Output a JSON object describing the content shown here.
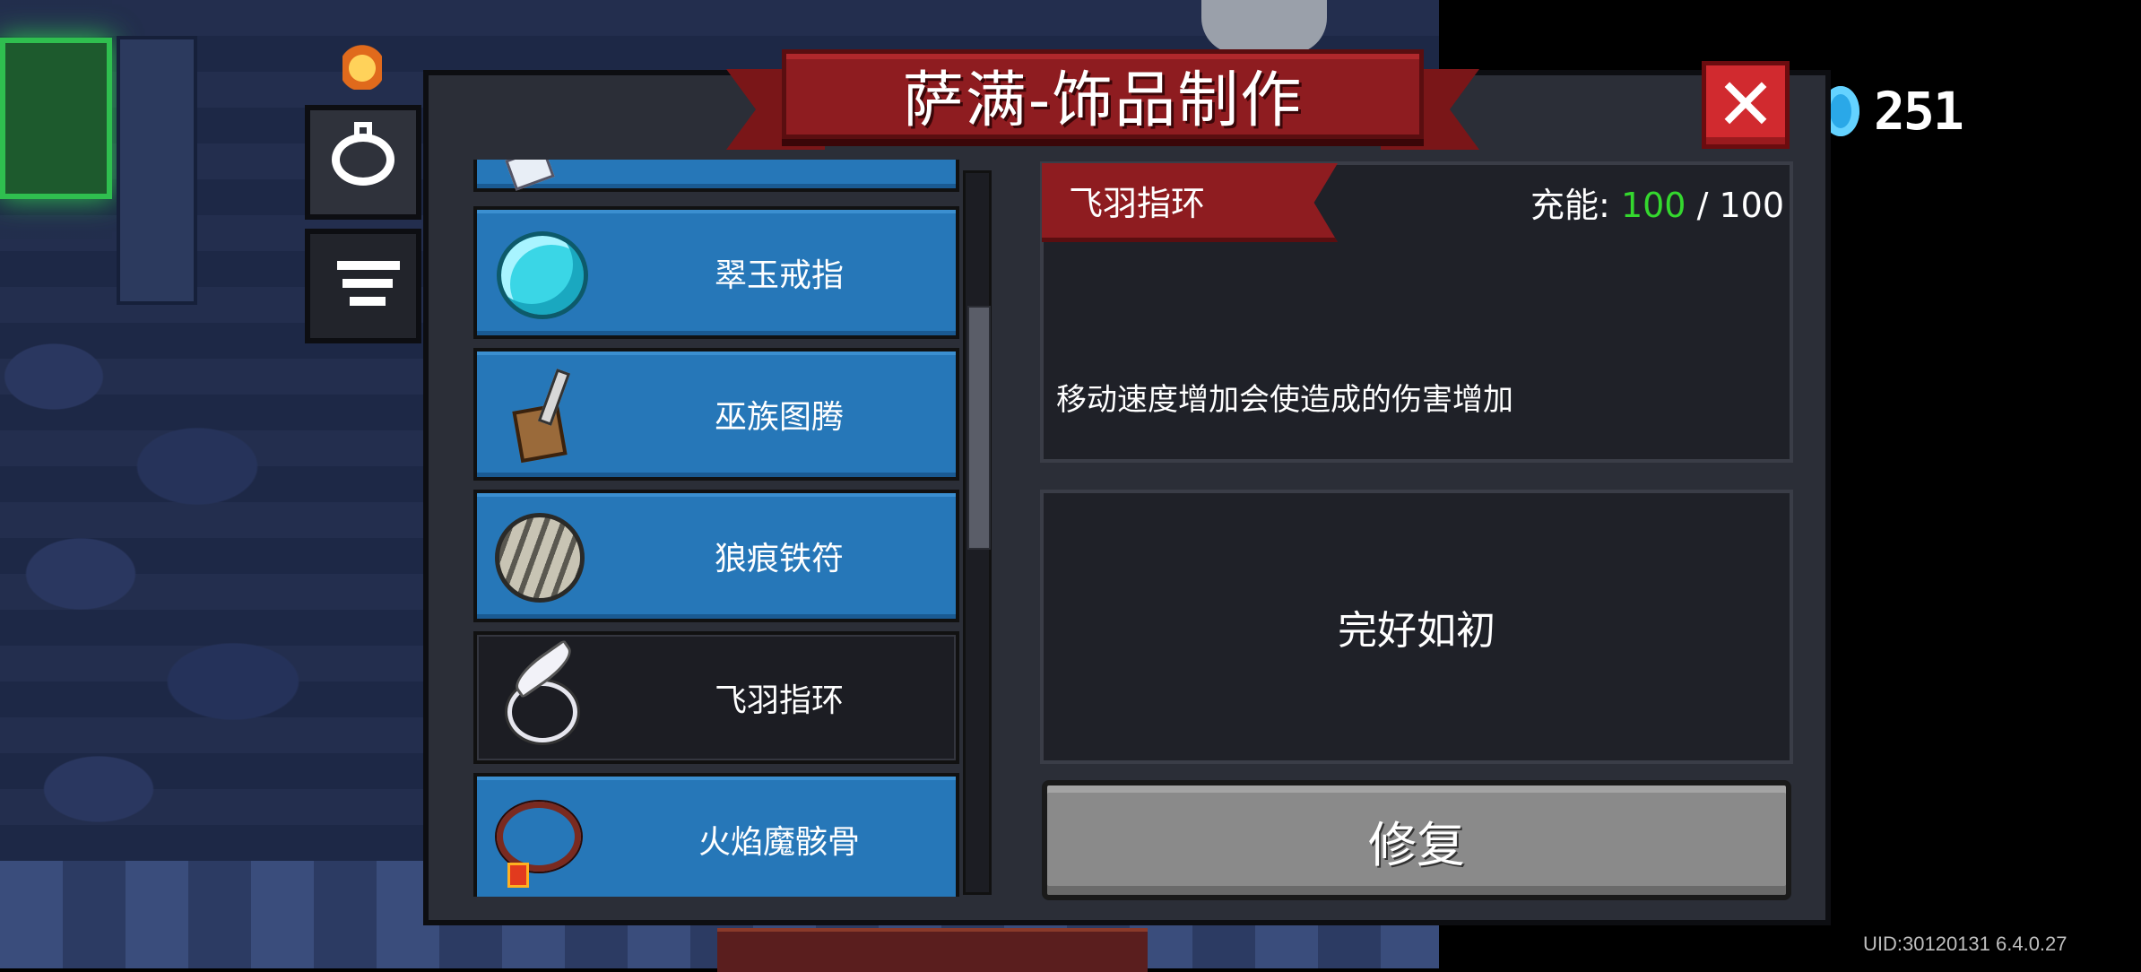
{
  "header": {
    "title": "萨满-饰品制作"
  },
  "currency": {
    "value": "251",
    "icon": "blue-gem-icon",
    "color": "#2aa8e8"
  },
  "tabs": [
    {
      "name": "ring-category",
      "icon": "ring-icon",
      "active": true
    },
    {
      "name": "filter",
      "icon": "filter-icon",
      "active": false
    }
  ],
  "items": [
    {
      "label": "",
      "icon": "accessory-icon"
    },
    {
      "label": "翠玉戒指",
      "icon": "jade-ring-icon"
    },
    {
      "label": "巫族图腾",
      "icon": "totem-icon"
    },
    {
      "label": "狼痕铁符",
      "icon": "wolf-talisman-icon"
    },
    {
      "label": "飞羽指环",
      "icon": "feather-ring-icon",
      "selected": true
    },
    {
      "label": "火焰魔骸骨",
      "icon": "fire-bone-necklace-icon"
    }
  ],
  "detail": {
    "name": "飞羽指环",
    "charge_label": "充能:",
    "charge_current": "100",
    "charge_max": "/ 100",
    "description": "移动速度增加会使造成的伤害增加",
    "condition": "完好如初",
    "repair_label": "修复"
  },
  "colors": {
    "accent_red": "#8e1c20",
    "item_blue": "#2677b8",
    "charge_green": "#34d82e"
  },
  "footer": {
    "uid": "UID:30120131 6.4.0.27"
  }
}
